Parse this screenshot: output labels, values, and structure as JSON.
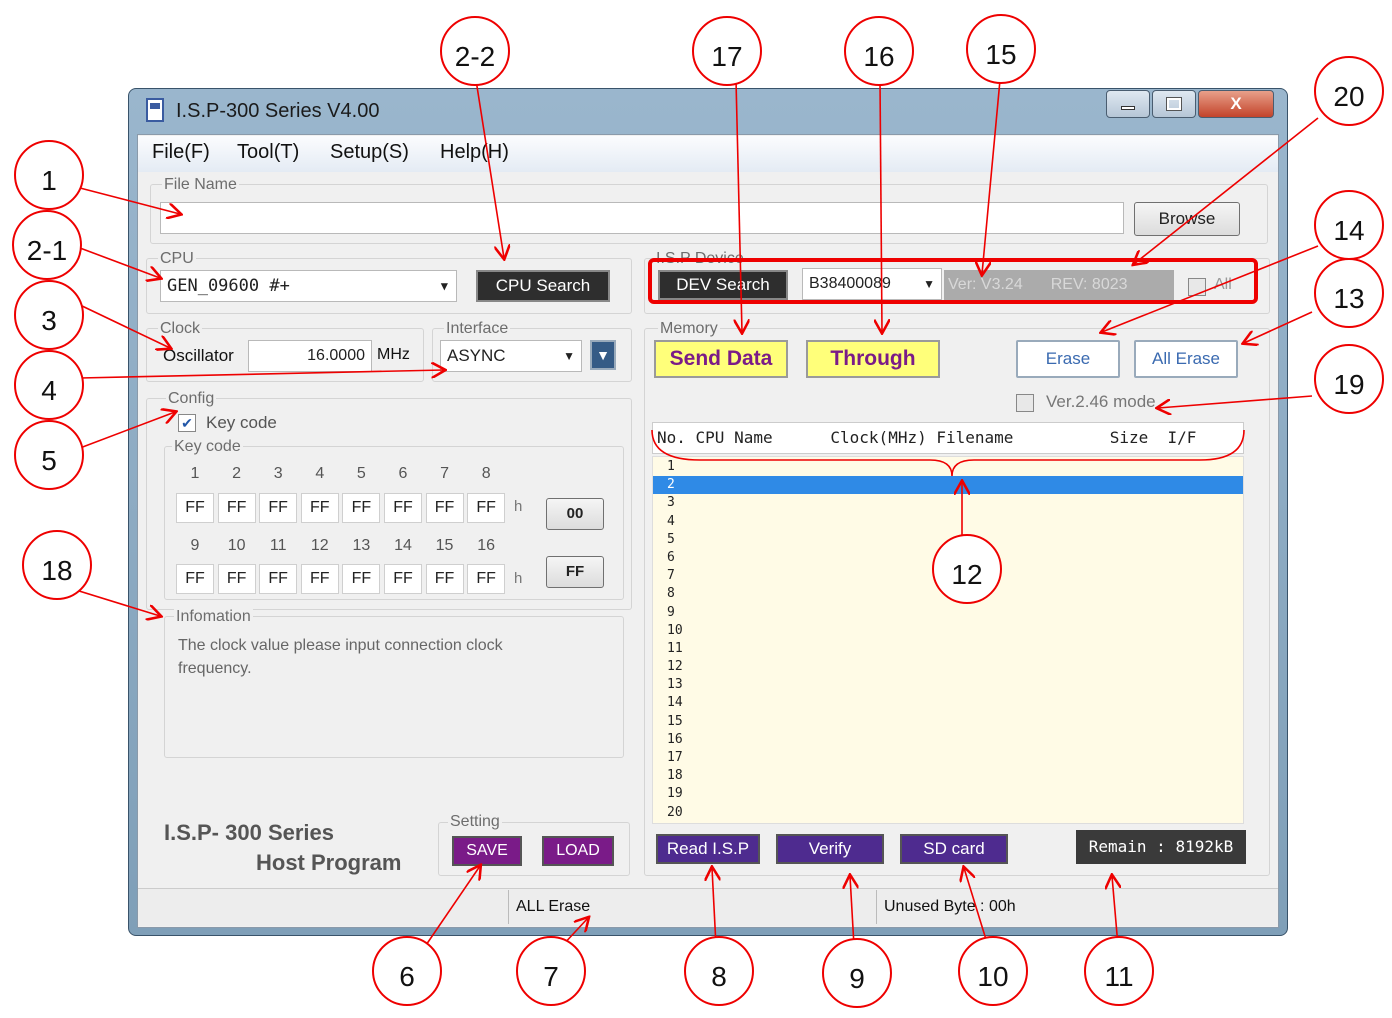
{
  "window": {
    "title": "I.S.P-300 Series V4.00",
    "close_label": "X"
  },
  "menu": [
    {
      "label": "File(F)"
    },
    {
      "label": "Tool(T)"
    },
    {
      "label": "Setup(S)"
    },
    {
      "label": "Help(H)"
    }
  ],
  "file": {
    "group_label": "File Name",
    "value": "",
    "browse_label": "Browse"
  },
  "cpu": {
    "group_label": "CPU",
    "selected": "GEN_09600 #+",
    "search_label": "CPU Search"
  },
  "clock": {
    "group_label": "Clock",
    "oscillator_label": "Oscillator",
    "value": "16.0000",
    "unit": "MHz"
  },
  "interface": {
    "group_label": "Interface",
    "selected": "ASYNC"
  },
  "config": {
    "group_label": "Config",
    "keycode_checkbox_label": "Key code",
    "keycode_checked": true,
    "keycode_group_label": "Key code",
    "numbers_row1": [
      "1",
      "2",
      "3",
      "4",
      "5",
      "6",
      "7",
      "8"
    ],
    "values_row1": [
      "FF",
      "FF",
      "FF",
      "FF",
      "FF",
      "FF",
      "FF",
      "FF"
    ],
    "numbers_row2": [
      "9",
      "10",
      "11",
      "12",
      "13",
      "14",
      "15",
      "16"
    ],
    "values_row2": [
      "FF",
      "FF",
      "FF",
      "FF",
      "FF",
      "FF",
      "FF",
      "FF"
    ],
    "h_suffix": "h",
    "btn_00": "00",
    "btn_ff": "FF"
  },
  "info": {
    "group_label": "Infomation",
    "text": "The clock value please input connection clock frequency."
  },
  "brand": {
    "line1": "I.S.P- 300  Series",
    "line2": "Host Program"
  },
  "setting": {
    "group_label": "Setting",
    "save_label": "SAVE",
    "load_label": "LOAD"
  },
  "device": {
    "group_label": "I.S.P Device",
    "search_label": "DEV Search",
    "selected": "B38400089",
    "ver": "Ver: V3.24",
    "rev": "REV: 8023",
    "all_label": "All"
  },
  "memory": {
    "group_label": "Memory",
    "send_label": "Send Data",
    "through_label": "Through",
    "erase_label": "Erase",
    "all_erase_label": "All Erase",
    "ver246_label": "Ver.2.46 mode",
    "header": "No. CPU Name      Clock(MHz) Filename          Size  I/F",
    "rows": [
      "1",
      "2",
      "3",
      "4",
      "5",
      "6",
      "7",
      "8",
      "9",
      "10",
      "11",
      "12",
      "13",
      "14",
      "15",
      "16",
      "17",
      "18",
      "19",
      "20"
    ],
    "selected_row": 2
  },
  "bottom": {
    "read_label": "Read I.S.P",
    "verify_label": "Verify",
    "sd_label": "SD card",
    "remain": "Remain : 8192kB"
  },
  "status": {
    "left": "ALL Erase",
    "right": "Unused Byte : 00h"
  },
  "callouts": [
    "1",
    "2-1",
    "2-2",
    "3",
    "4",
    "5",
    "6",
    "7",
    "8",
    "9",
    "10",
    "11",
    "12",
    "13",
    "14",
    "15",
    "16",
    "17",
    "18",
    "19",
    "20"
  ],
  "colors": {
    "accent": "#7a1b88",
    "callout": "#e00000",
    "selection": "#2f8ae6",
    "list_bg": "#fffbe6"
  }
}
